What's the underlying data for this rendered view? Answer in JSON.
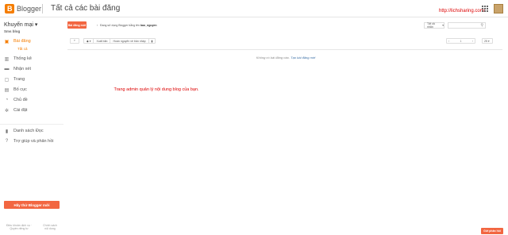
{
  "header": {
    "brand": "Blogger",
    "title": "Tất cả các bài đăng",
    "watermark": "http://lichsharing.com/",
    "logo_letter": "B"
  },
  "sidebar": {
    "blog_name": "Khuyến mại",
    "blog_sub": "Sms blog",
    "items": [
      {
        "label": "Bài đăng",
        "icon": "posts-icon",
        "active": true
      },
      {
        "label": "Thống kê",
        "icon": "stats-icon"
      },
      {
        "label": "Nhận xét",
        "icon": "comments-icon"
      },
      {
        "label": "Trang",
        "icon": "pages-icon"
      },
      {
        "label": "Bố cục",
        "icon": "layout-icon"
      },
      {
        "label": "Chủ đề",
        "icon": "theme-icon"
      },
      {
        "label": "Cài đặt",
        "icon": "settings-icon"
      },
      {
        "label": "Danh sách Đọc",
        "icon": "bookmark-icon"
      },
      {
        "label": "Trợ giúp và phản hồi",
        "icon": "help-icon"
      }
    ],
    "sub_item": "Tất cả",
    "new_blog_button": "Hãy thử Blogger mới",
    "footer_left": "Điều khoản dịch vụ · Quyền riêng tư",
    "footer_right": "Chính sách nội dung"
  },
  "main": {
    "new_post_button": "Bài đăng mới",
    "notice_prefix": "Đang sử dụng Blogger bằng tên ",
    "notice_user": "bao_nguyen",
    "filter_select": "Tất cả nhãn",
    "toolbar": {
      "label_btn": "▾",
      "publish": "Xuất bản",
      "revert": "Hoàn nguyên về bản nháp"
    },
    "pager": {
      "prev": "‹",
      "page": "1",
      "next": "›"
    },
    "per_page": "25",
    "empty_text": "Không có bài đăng nào.",
    "empty_link": "Tạo bài đăng mới",
    "annotation": "Trang admin quản lý nội dung blog của bạn.",
    "help_button": "Gửi phản hồi"
  },
  "colors": {
    "accent": "#f57d00",
    "button": "#f26641",
    "annotation": "#dd0000"
  }
}
